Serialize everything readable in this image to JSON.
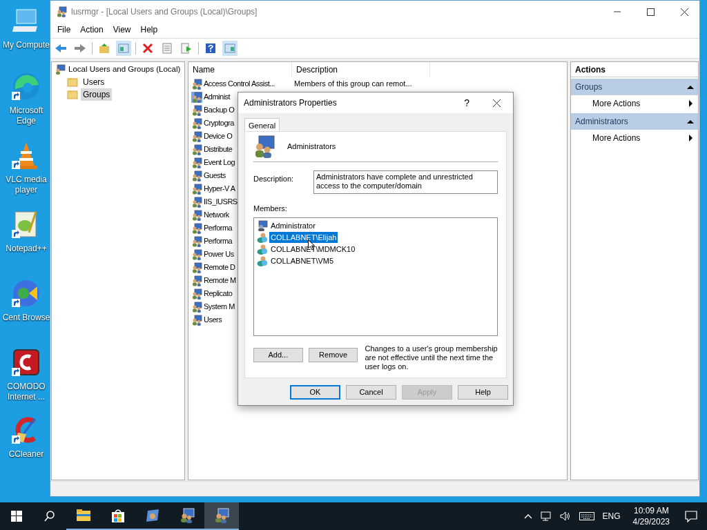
{
  "desktop_icons": [
    {
      "kind": "computer",
      "label": "My Compute"
    },
    {
      "kind": "edge",
      "label": "Microsoft Edge"
    },
    {
      "kind": "vlc",
      "label": "VLC media player"
    },
    {
      "kind": "notepad",
      "label": "Notepad++"
    },
    {
      "kind": "cent",
      "label": "Cent Browse"
    },
    {
      "kind": "comodo",
      "label": "COMODO Internet ..."
    },
    {
      "kind": "ccleaner",
      "label": "CCleaner"
    }
  ],
  "window": {
    "title": "lusrmgr - [Local Users and Groups (Local)\\Groups]"
  },
  "menu": [
    "File",
    "Action",
    "View",
    "Help"
  ],
  "tree": {
    "label": "Local Users and Groups (Local)",
    "children": [
      {
        "label": "Users",
        "selected": false
      },
      {
        "label": "Groups",
        "selected": true
      }
    ]
  },
  "list": {
    "columns": [
      "Name",
      "Description"
    ],
    "rows": [
      {
        "name": "Access Control Assist...",
        "description": "Members of this group can remot...",
        "selected": false
      },
      {
        "name": "Administ",
        "selected": true
      },
      {
        "name": "Backup O",
        "selected": false
      },
      {
        "name": "Cryptogra",
        "selected": false
      },
      {
        "name": "Device O",
        "selected": false
      },
      {
        "name": "Distribute",
        "selected": false
      },
      {
        "name": "Event Log",
        "selected": false
      },
      {
        "name": "Guests",
        "selected": false
      },
      {
        "name": "Hyper-V A",
        "selected": false
      },
      {
        "name": "IIS_IUSRS",
        "selected": false
      },
      {
        "name": "Network",
        "selected": false
      },
      {
        "name": "Performa",
        "selected": false
      },
      {
        "name": "Performa",
        "selected": false
      },
      {
        "name": "Power Us",
        "selected": false
      },
      {
        "name": "Remote D",
        "selected": false
      },
      {
        "name": "Remote M",
        "selected": false
      },
      {
        "name": "Replicato",
        "selected": false
      },
      {
        "name": "System M",
        "selected": false
      },
      {
        "name": "Users",
        "selected": false
      }
    ]
  },
  "actions": {
    "title": "Actions",
    "sections": [
      {
        "title": "Groups",
        "items": [
          "More Actions"
        ]
      },
      {
        "title": "Administrators",
        "items": [
          "More Actions"
        ]
      }
    ]
  },
  "dialog": {
    "title": "Administrators Properties",
    "help": "?",
    "tabs": [
      {
        "label": "General",
        "selected": true
      }
    ],
    "group_name": "Administrators",
    "description_label": "Description:",
    "description": "Administrators have complete and unrestricted access to the computer/domain",
    "members_label": "Members:",
    "members": [
      {
        "kind": "local",
        "name": "Administrator",
        "selected": false
      },
      {
        "kind": "domain",
        "name": "COLLABNET\\Elijah",
        "selected": true
      },
      {
        "kind": "domain",
        "name": "COLLABNET\\MDMCK10",
        "selected": false
      },
      {
        "kind": "domain",
        "name": "COLLABNET\\VM5",
        "selected": false
      }
    ],
    "member_buttons": [
      "Add...",
      "Remove"
    ],
    "note": "Changes to a user's group membership are not effective until the next time the user logs on.",
    "buttons": [
      {
        "label": "OK",
        "default": true,
        "disabled": false
      },
      {
        "label": "Cancel",
        "default": false,
        "disabled": false
      },
      {
        "label": "Apply",
        "default": false,
        "disabled": true
      },
      {
        "label": "Help",
        "default": false,
        "disabled": false
      }
    ]
  },
  "taskbar": {
    "apps": [
      {
        "kind": "explorer",
        "selected": false
      },
      {
        "kind": "store",
        "selected": false
      },
      {
        "kind": "tool",
        "selected": false
      },
      {
        "kind": "users",
        "selected": false
      },
      {
        "kind": "users",
        "selected": true
      }
    ],
    "language": "ENG",
    "time": "10:09 AM",
    "date": "4/29/2023"
  }
}
